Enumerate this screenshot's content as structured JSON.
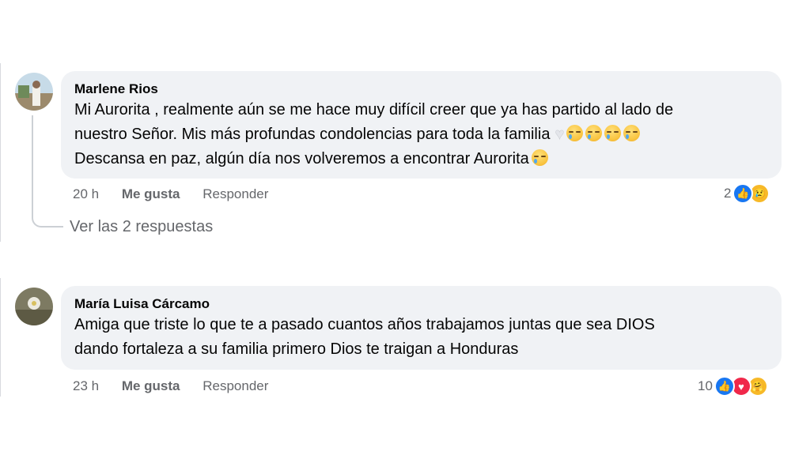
{
  "comments": [
    {
      "author": "Marlene Rios",
      "lines": [
        "Mi Aurorita , realmente aún se me hace muy difícil creer que ya has partido al lado de",
        "nuestro Señor. Mis más profundas condolencias para toda la familia",
        "Descansa en paz, algún día nos volveremos a encontrar Aurorita"
      ],
      "time": "20 h",
      "like_label": "Me gusta",
      "reply_label": "Responder",
      "reaction_count": "2",
      "reactions": [
        "like-icon",
        "sad-icon"
      ],
      "view_replies": "Ver las 2 respuestas"
    },
    {
      "author": "María Luisa Cárcamo",
      "lines": [
        "Amiga que triste lo que te a pasado cuantos años trabajamos juntas que sea DIOS",
        "dando fortaleza a su familia primero Dios te traigan a Honduras"
      ],
      "time": "23 h",
      "like_label": "Me gusta",
      "reply_label": "Responder",
      "reaction_count": "10",
      "reactions": [
        "like-icon",
        "love-icon",
        "care-icon"
      ]
    }
  ],
  "colors": {
    "bubble": "#f0f2f5",
    "meta_text": "#65676b",
    "like": "#1877f2",
    "love": "#f0284a",
    "emoji": "#f7b928"
  }
}
